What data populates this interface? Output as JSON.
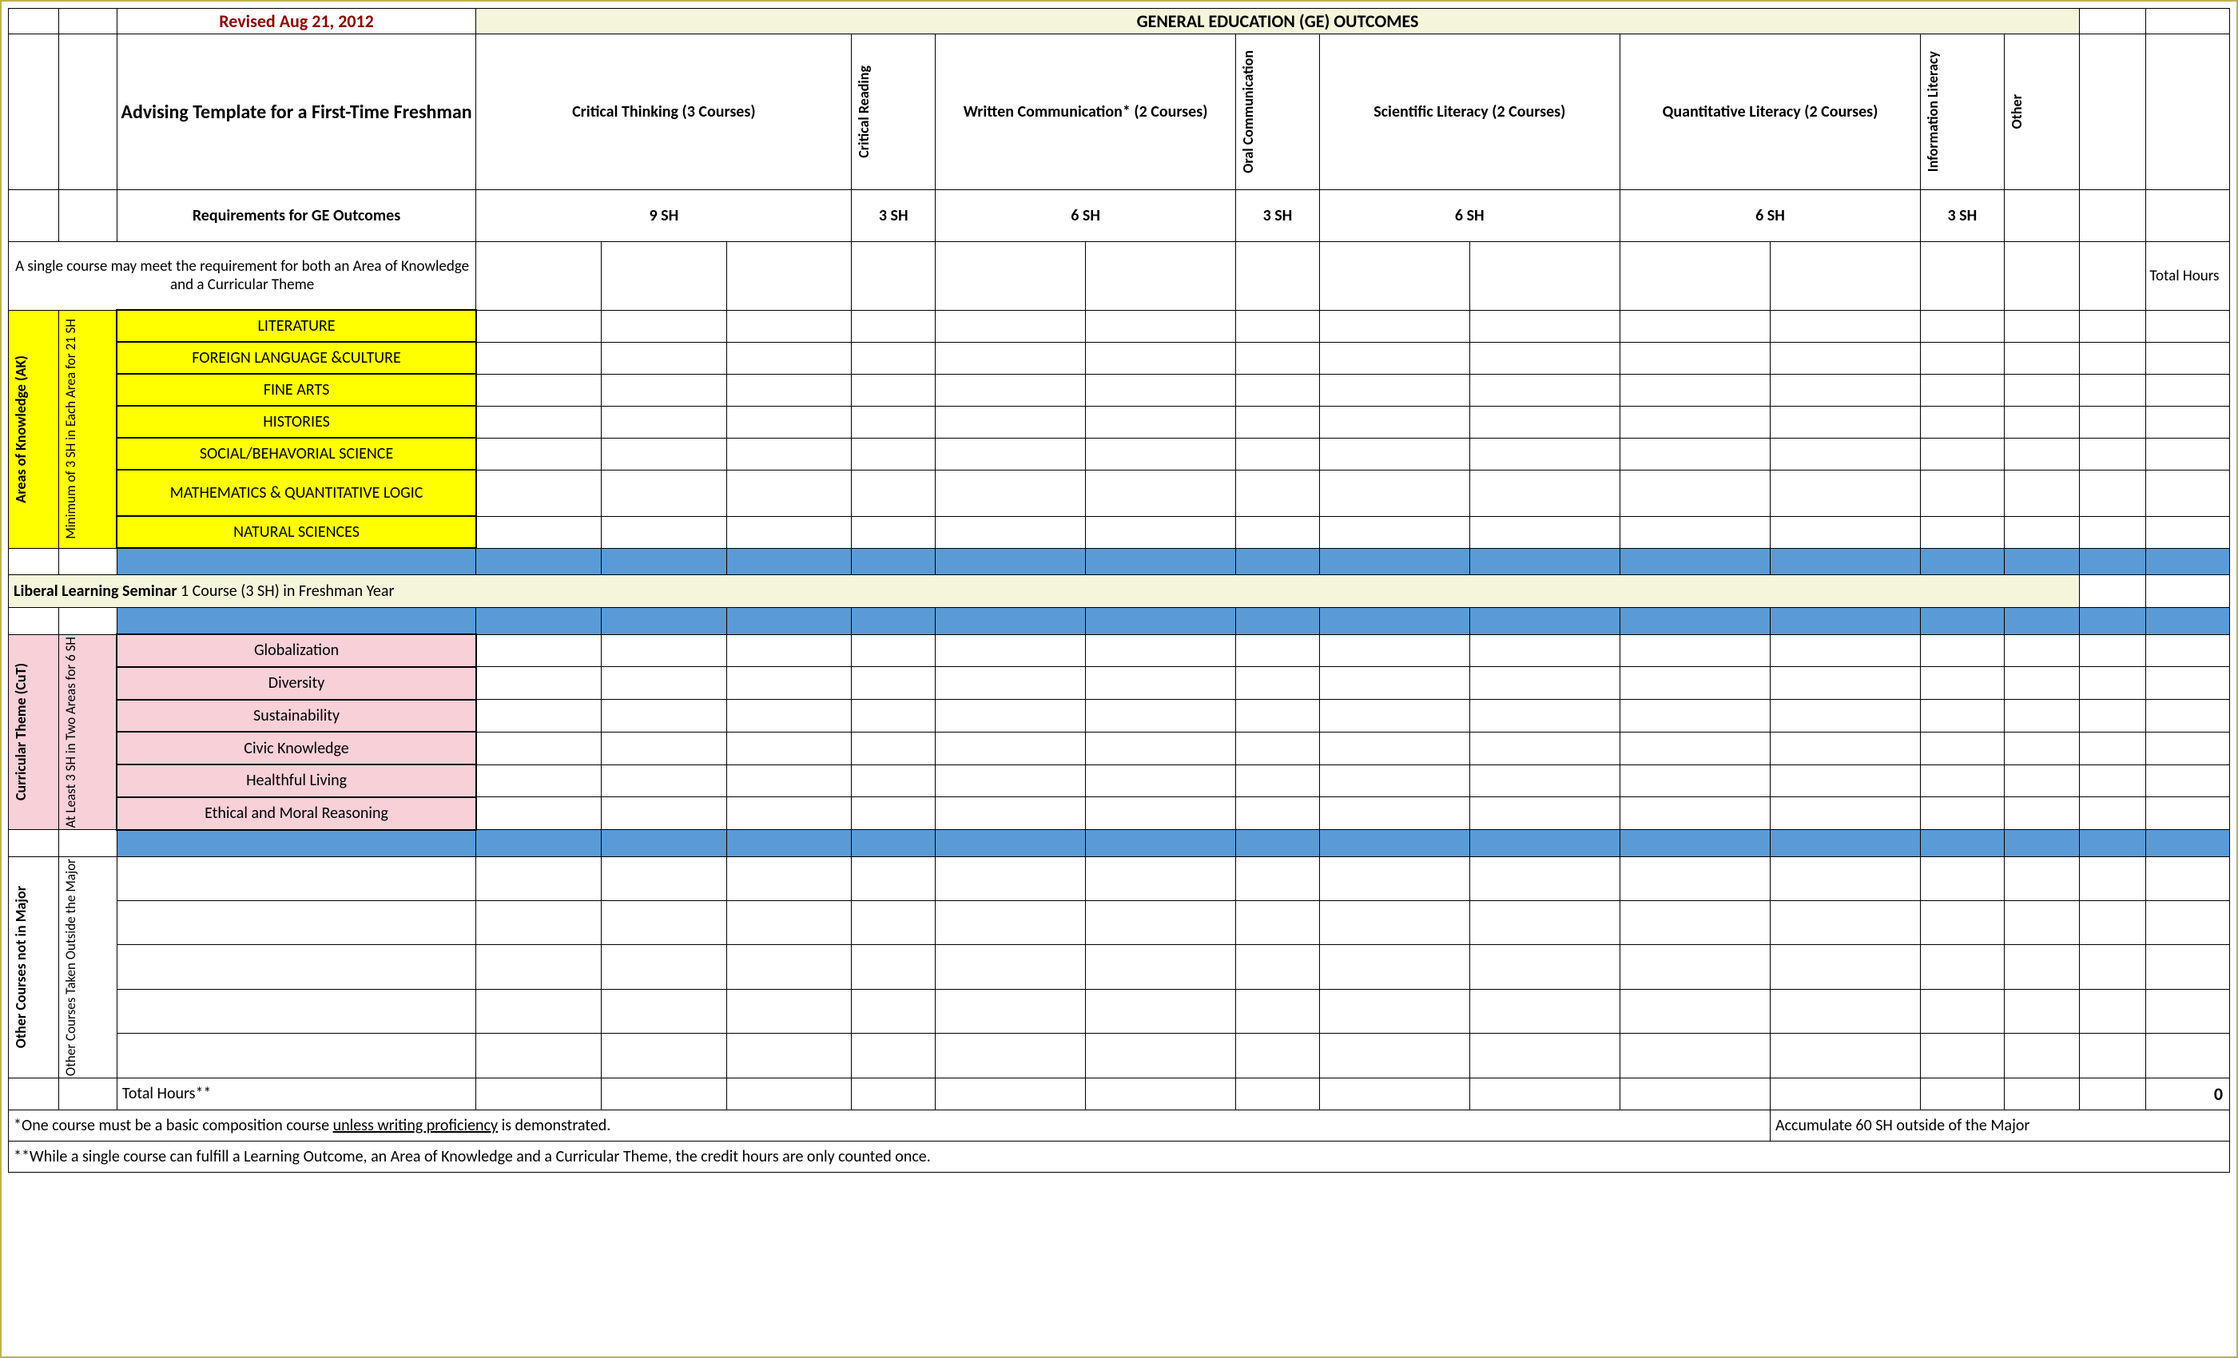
{
  "header": {
    "revised": "Revised Aug 21, 2012",
    "ge_outcomes": "GENERAL EDUCATION (GE) OUTCOMES",
    "title": "Advising Template for a First-Time Freshman",
    "requirements_label": "Requirements for GE Outcomes"
  },
  "columns": {
    "critical_thinking": "Critical Thinking (3 Courses)",
    "critical_reading": "Critical Reading",
    "written_comm": "Written Communication*  (2 Courses)",
    "oral_comm": "Oral Communication",
    "scientific": "Scientific Literacy           (2 Courses)",
    "quantitative": "Quantitative Literacy        (2 Courses)",
    "info_literacy": "Information Literacy",
    "other": "Other"
  },
  "sh": {
    "ct": "9 SH",
    "cr": "3 SH",
    "wc": "6 SH",
    "oc": "3 SH",
    "sl": "6 SH",
    "ql": "6 SH",
    "il": "3 SH"
  },
  "note": "A single course may meet the requirement for both an Area of Knowledge and a Curricular Theme",
  "total_hours_label": "Total Hours",
  "ak": {
    "label": "Areas of Knowledge (AK)",
    "sub": "Minimum of 3 SH in Each Area for 21 SH",
    "items": [
      "LITERATURE",
      "FOREIGN LANGUAGE &CULTURE",
      "FINE ARTS",
      "HISTORIES",
      "SOCIAL/BEHAVORIAL SCIENCE",
      "MATHEMATICS & QUANTITATIVE LOGIC",
      "NATURAL SCIENCES"
    ]
  },
  "lls": {
    "bold": "Liberal Learning Seminar",
    "rest": "  1 Course (3 SH) in Freshman Year"
  },
  "cut": {
    "label": "Curricular Theme (CuT)",
    "sub": "At Least 3 SH in Two Areas for 6 SH",
    "items": [
      "Globalization",
      "Diversity",
      "Sustainability",
      "Civic Knowledge",
      "Healthful Living",
      "Ethical and Moral Reasoning"
    ]
  },
  "other_section": {
    "label": "Other Courses not in Major",
    "sub": "Other Courses Taken Outside the Major"
  },
  "totals": {
    "label": "Total Hours**",
    "value": "0"
  },
  "footers": {
    "f1a": "*One course must be a basic composition course ",
    "f1u": "unless writing proficiency",
    "f1b": " is demonstrated.",
    "f1r": "Accumulate 60 SH outside of the Major",
    "f2": "**While a single course can fulfill a Learning Outcome, an Area of Knowledge and a Curricular Theme, the credit hours are only counted once."
  }
}
